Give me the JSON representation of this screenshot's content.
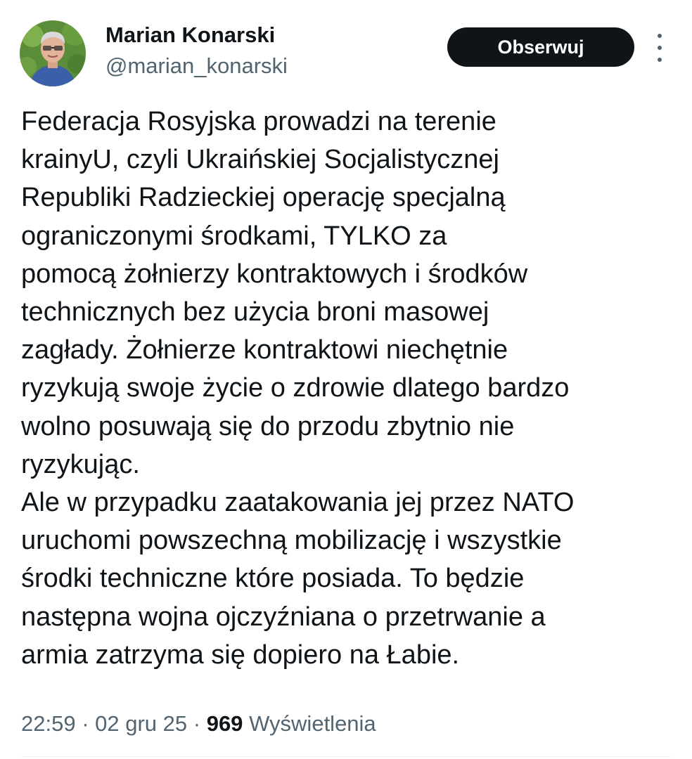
{
  "author": {
    "display_name": "Marian Konarski",
    "handle": "@marian_konarski"
  },
  "follow_button": {
    "label": "Obserwuj"
  },
  "more_menu": {
    "icon": "more-vertical-icon"
  },
  "tweet": {
    "lines": [
      "Federacja Rosyjska prowadzi na terenie",
      "krainyU, czyli Ukraińskiej Socjalistycznej",
      "Republiki Radzieckiej operację specjalną",
      "ograniczonymi środkami, TYLKO  za",
      "pomocą żołnierzy kontraktowych i środków",
      "technicznych bez użycia broni masowej",
      "zagłady. Żołnierze kontraktowi niechętnie",
      "ryzykują swoje życie o zdrowie dlatego bardzo",
      "wolno posuwają się do przodu zbytnio nie",
      "ryzykując.",
      "Ale w przypadku zaatakowania jej przez NATO",
      "uruchomi powszechną mobilizację i wszystkie",
      "środki techniczne które posiada. To będzie",
      "następna wojna ojczyźniana o przetrwanie a",
      "armia zatrzyma się dopiero na Łabie."
    ]
  },
  "meta": {
    "time": "22:59",
    "separator": " · ",
    "date": "02 gru 25",
    "views_count": "969",
    "views_label": "Wyświetlenia"
  },
  "colors": {
    "text": "#0f1419",
    "secondary": "#536471",
    "button_bg": "#0f1419",
    "button_text": "#ffffff"
  }
}
